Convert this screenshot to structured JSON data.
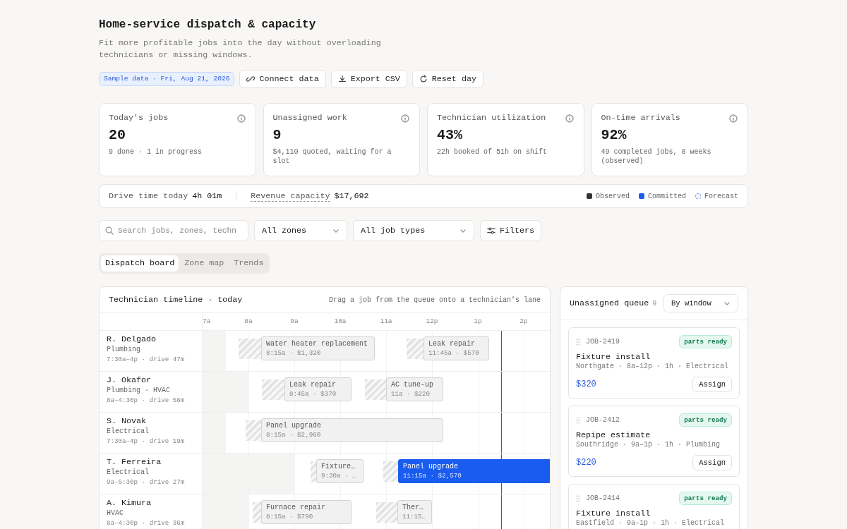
{
  "header": {
    "title": "Home-service dispatch & capacity",
    "subtitle": "Fit more profitable jobs into the day without overloading technicians or missing windows."
  },
  "toolbar": {
    "badge": "Sample data · Fri, Aug 21, 2026",
    "buttons": [
      {
        "label": "Connect data",
        "kind": "link"
      },
      {
        "label": "Export CSV",
        "kind": "download"
      },
      {
        "label": "Reset day",
        "kind": "reset"
      }
    ]
  },
  "stats": [
    {
      "label": "Today's jobs",
      "value": "20",
      "note": "9 done · 1 in progress"
    },
    {
      "label": "Unassigned work",
      "value": "9",
      "note": "$4,110 quoted, waiting for a slot"
    },
    {
      "label": "Technician utilization",
      "value": "43%",
      "note": "22h booked of 51h on shift"
    },
    {
      "label": "On-time arrivals",
      "value": "92%",
      "note": "49 completed jobs, 8 weeks (observed)"
    }
  ],
  "summary": {
    "drive_label": "Drive time today",
    "drive_value": "4h 01m",
    "revenue_label": "Revenue capacity",
    "revenue_value": "$17,692",
    "legend": [
      {
        "label": "Observed",
        "kind": "solid",
        "color": "#333333"
      },
      {
        "label": "Committed",
        "kind": "solid",
        "color": "#1a5cf0"
      },
      {
        "label": "Forecast",
        "kind": "dashed",
        "color": "#8fb0f0"
      }
    ]
  },
  "filters": {
    "search_placeholder": "Search jobs, zones, techn",
    "selects": [
      "All zones",
      "All job types"
    ],
    "filters_button": "Filters"
  },
  "tabs": [
    {
      "label": "Dispatch board",
      "selected": true
    },
    {
      "label": "Zone map",
      "selected": false
    },
    {
      "label": "Trends",
      "selected": false
    }
  ],
  "timeline": {
    "title": "Technician timeline · today",
    "hint": "Drag a job from the queue onto a technician's lane",
    "hours": [
      "7a",
      "8a",
      "9a",
      "10a",
      "11a",
      "12p",
      "1p",
      "2p"
    ],
    "lanes": [
      {
        "name": "R. Delgado",
        "skills": "Plumbing",
        "shift": "7:30a–4p · drive 47m",
        "jobs": [
          {
            "title": "Water heater replacement",
            "detail": "8:15a · $1,320",
            "selected": false
          },
          {
            "title": "Leak repair",
            "detail": "11:45a · $570",
            "selected": false
          }
        ]
      },
      {
        "name": "J. Okafor",
        "skills": "Plumbing · HVAC",
        "shift": "8a–4:30p · drive 56m",
        "jobs": [
          {
            "title": "Leak repair",
            "detail": "8:45a · $370",
            "selected": false
          },
          {
            "title": "AC tune-up",
            "detail": "11a · $220",
            "selected": false
          }
        ]
      },
      {
        "name": "S. Novak",
        "skills": "Electrical",
        "shift": "7:30a–4p · drive 19m",
        "jobs": [
          {
            "title": "Panel upgrade",
            "detail": "8:15a · $2,960",
            "selected": false
          }
        ]
      },
      {
        "name": "T. Ferreira",
        "skills": "Electrical",
        "shift": "9a–5:30p · drive 27m",
        "jobs": [
          {
            "title": "Fixture…",
            "detail": "9:30a · …",
            "selected": false
          },
          {
            "title": "Panel upgrade",
            "detail": "11:15a · $2,570",
            "selected": true
          }
        ]
      },
      {
        "name": "A. Kimura",
        "skills": "HVAC",
        "shift": "8a–4:30p · drive 36m",
        "jobs": [
          {
            "title": "Furnace repair",
            "detail": "8:15a · $790",
            "selected": false
          },
          {
            "title": "Ther…",
            "detail": "11:15…",
            "selected": false
          }
        ]
      }
    ]
  },
  "queue": {
    "title": "Unassigned queue",
    "count": "9",
    "sort": "By window",
    "cards": [
      {
        "id": "JOB-2419",
        "badge": "parts ready",
        "title": "Fixture install",
        "meta": "Northgate · 8a–12p · 1h · Electrical",
        "price": "$320",
        "action": "Assign"
      },
      {
        "id": "JOB-2412",
        "badge": "parts ready",
        "title": "Repipe estimate",
        "meta": "Southridge · 9a–1p · 1h · Plumbing",
        "price": "$220",
        "action": "Assign"
      },
      {
        "id": "JOB-2414",
        "badge": "parts ready",
        "title": "Fixture install",
        "meta": "Eastfield · 9a–1p · 1h · Electrical"
      }
    ]
  }
}
